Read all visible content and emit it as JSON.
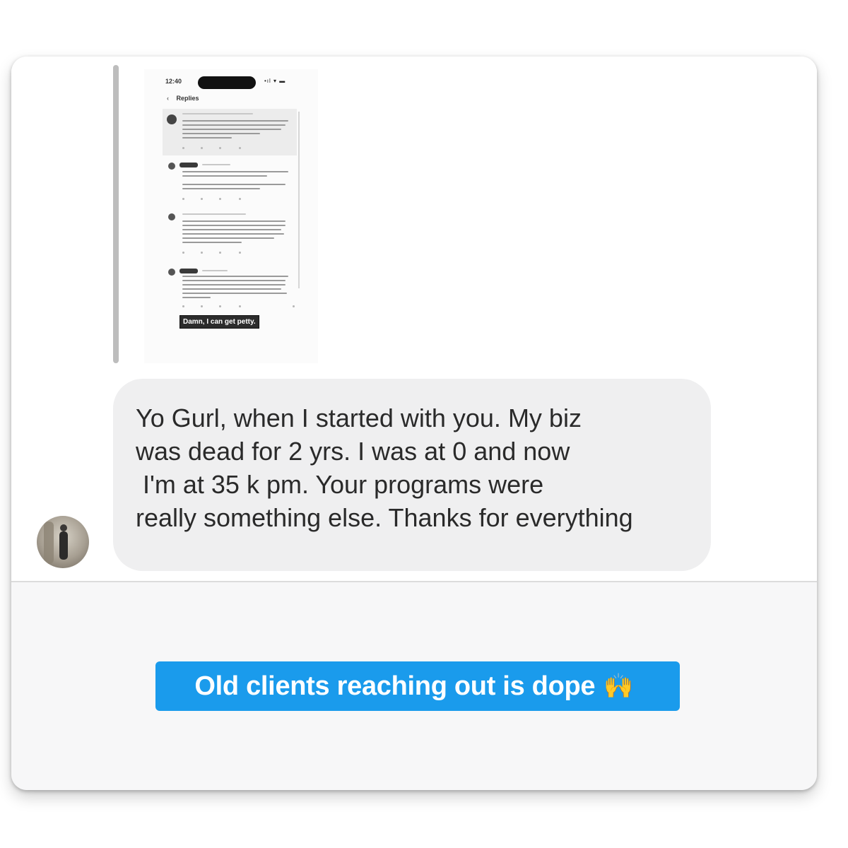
{
  "reply": {
    "screenshot": {
      "status_time": "12:40",
      "status_icons": "•ıl ▾ ▬",
      "back_icon": "chevron-left-icon",
      "title": "Replies",
      "footer_caption": "Damn, I can get petty."
    }
  },
  "message": {
    "text": "Yo Gurl, when I started with you. My biz\nwas dead for 2 yrs. I was at 0 and now\n I'm at 35 k pm. Your programs were\nreally something else. Thanks for everything"
  },
  "caption": {
    "text": "Old clients reaching out is dope",
    "emoji": "🙌"
  },
  "colors": {
    "caption_bg": "#1a9bec",
    "bubble_bg": "#efeff0"
  }
}
